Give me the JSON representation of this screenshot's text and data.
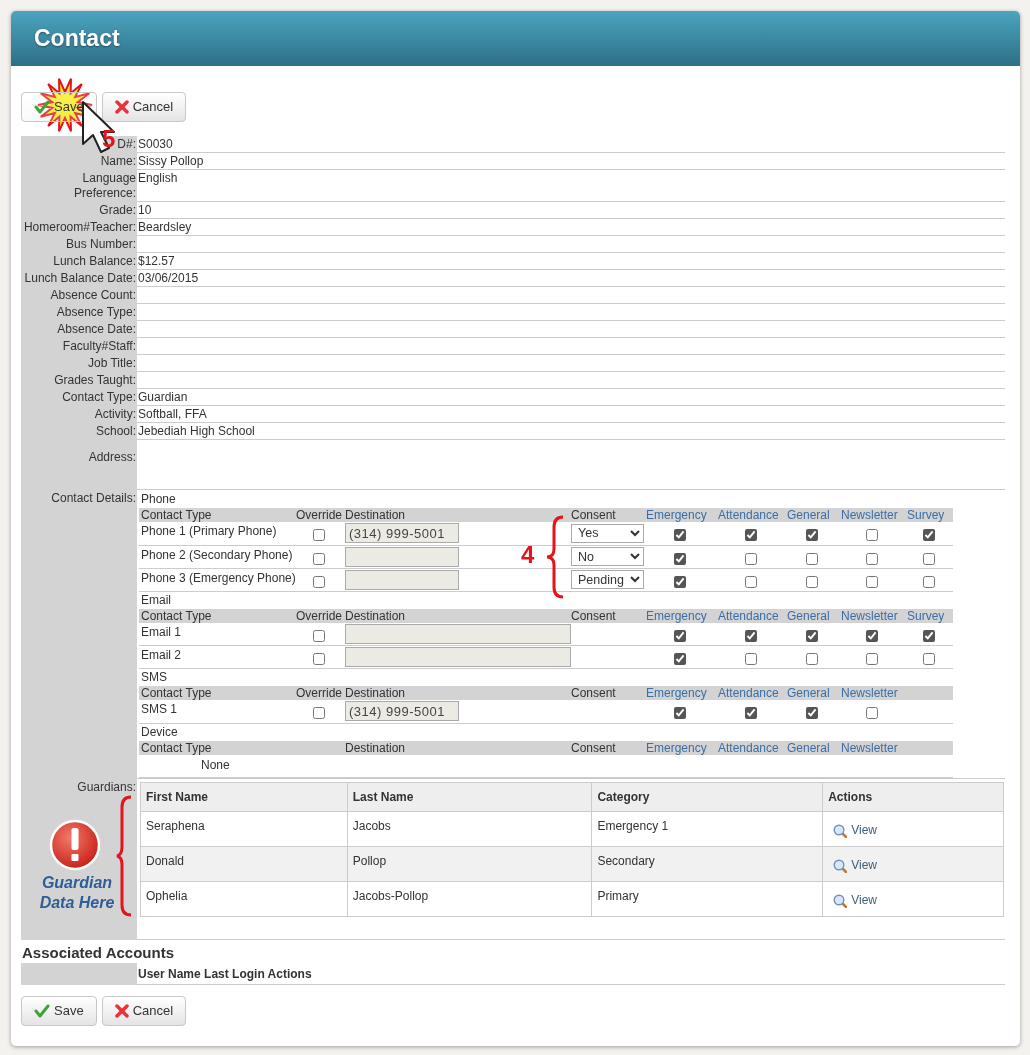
{
  "header": {
    "title": "Contact"
  },
  "top_buttons": [
    {
      "kind": "save",
      "label": "Save"
    },
    {
      "kind": "cancel",
      "label": "Cancel"
    }
  ],
  "top_callout": "5",
  "fields": [
    {
      "kind": "line",
      "label": "D#:",
      "value": "S0030"
    },
    {
      "kind": "line",
      "label": "Name:",
      "value": "Sissy Pollop"
    },
    {
      "kind": "line",
      "label": "Language Preference:",
      "value": "English"
    },
    {
      "kind": "line",
      "label": "Grade:",
      "value": "10"
    },
    {
      "kind": "line",
      "label": "Homeroom#Teacher:",
      "value": "Beardsley"
    },
    {
      "kind": "line",
      "label": "Bus Number:"
    },
    {
      "kind": "line",
      "label": "Lunch Balance:",
      "value": "$12.57"
    },
    {
      "kind": "line",
      "label": "Lunch Balance Date:",
      "value": "03/06/2015"
    },
    {
      "kind": "line",
      "label": "Absence Count:"
    },
    {
      "kind": "line",
      "label": "Absence Type:"
    },
    {
      "kind": "line",
      "label": "Absence Date:"
    },
    {
      "kind": "line",
      "label": "Faculty#Staff:"
    },
    {
      "kind": "line",
      "label": "Job Title:"
    },
    {
      "kind": "line",
      "label": "Grades Taught:"
    },
    {
      "kind": "line",
      "label": "Contact Type:",
      "value": "Guardian"
    },
    {
      "kind": "line",
      "label": "Activity:",
      "value": "Softball, FFA"
    },
    {
      "kind": "line",
      "label": "School:",
      "value": "Jebediah High School"
    },
    {
      "kind": "block",
      "label": "Address:"
    }
  ],
  "contact_details": {
    "label": "Contact Details:",
    "sections": [
      {
        "kind": "phone",
        "title": "Phone",
        "callout": "4",
        "columns": [
          {
            "kind": "type",
            "label": "Contact Type"
          },
          {
            "kind": "override",
            "label": "Override"
          },
          {
            "kind": "destination",
            "label": "Destination"
          },
          {
            "kind": "consent",
            "label": "Consent"
          },
          {
            "kind": "pref",
            "label": "Emergency"
          },
          {
            "kind": "pref",
            "label": "Attendance"
          },
          {
            "kind": "pref",
            "label": "General"
          },
          {
            "kind": "pref",
            "label": "Newsletter"
          },
          {
            "kind": "pref",
            "label": "Survey"
          }
        ],
        "rows": [
          {
            "kind": "entry",
            "contact_type": "Phone 1 (Primary Phone)",
            "override": false,
            "destination": "(314) 999-5001",
            "consent": "Yes",
            "prefs": [
              true,
              true,
              true,
              false,
              true
            ]
          },
          {
            "kind": "entry",
            "contact_type": "Phone 2 (Secondary Phone)",
            "override": false,
            "consent": "No",
            "prefs": [
              true,
              false,
              false,
              false,
              false
            ]
          },
          {
            "kind": "entry",
            "contact_type": "Phone 3 (Emergency Phone)",
            "override": false,
            "consent": "Pending",
            "prefs": [
              true,
              false,
              false,
              false,
              false
            ]
          }
        ]
      },
      {
        "kind": "email",
        "title": "Email",
        "columns": [
          {
            "kind": "type",
            "label": "Contact Type"
          },
          {
            "kind": "override",
            "label": "Override"
          },
          {
            "kind": "destination",
            "label": "Destination"
          },
          {
            "kind": "consent",
            "label": "Consent"
          },
          {
            "kind": "pref",
            "label": "Emergency"
          },
          {
            "kind": "pref",
            "label": "Attendance"
          },
          {
            "kind": "pref",
            "label": "General"
          },
          {
            "kind": "pref",
            "label": "Newsletter"
          },
          {
            "kind": "pref",
            "label": "Survey"
          }
        ],
        "rows": [
          {
            "kind": "entry",
            "contact_type": "Email 1",
            "override": false,
            "prefs": [
              true,
              true,
              true,
              true,
              true
            ]
          },
          {
            "kind": "entry",
            "contact_type": "Email 2",
            "override": false,
            "prefs": [
              true,
              false,
              false,
              false,
              false
            ]
          }
        ]
      },
      {
        "kind": "sms",
        "title": "SMS",
        "columns": [
          {
            "kind": "type",
            "label": "Contact Type"
          },
          {
            "kind": "override",
            "label": "Override"
          },
          {
            "kind": "destination",
            "label": "Destination"
          },
          {
            "kind": "consent",
            "label": "Consent"
          },
          {
            "kind": "pref",
            "label": "Emergency"
          },
          {
            "kind": "pref",
            "label": "Attendance"
          },
          {
            "kind": "pref",
            "label": "General"
          },
          {
            "kind": "pref",
            "label": "Newsletter"
          }
        ],
        "rows": [
          {
            "kind": "entry",
            "contact_type": "SMS 1",
            "override": false,
            "destination": "(314) 999-5001",
            "prefs": [
              true,
              true,
              true,
              false
            ]
          }
        ]
      },
      {
        "kind": "device",
        "title": "Device",
        "columns": [
          {
            "kind": "type",
            "label": "Contact Type"
          },
          {
            "kind": "destination",
            "label": "Destination"
          },
          {
            "kind": "consent",
            "label": "Consent"
          },
          {
            "kind": "pref",
            "label": "Emergency"
          },
          {
            "kind": "pref",
            "label": "Attendance"
          },
          {
            "kind": "pref",
            "label": "General"
          },
          {
            "kind": "pref",
            "label": "Newsletter"
          }
        ],
        "rows": [
          {
            "kind": "empty",
            "text": "None"
          }
        ]
      }
    ]
  },
  "guardians": {
    "label": "Guardians:",
    "note": "Guardian Data Here",
    "columns": [
      "First Name",
      "Last Name",
      "Category",
      "Actions"
    ],
    "rows": [
      {
        "first_name": "Seraphena",
        "last_name": "Jacobs",
        "category": "Emergency 1",
        "action": "View"
      },
      {
        "first_name": "Donald",
        "last_name": "Pollop",
        "category": "Secondary",
        "action": "View"
      },
      {
        "first_name": "Ophelia",
        "last_name": "Jacobs-Pollop",
        "category": "Primary",
        "action": "View"
      }
    ]
  },
  "associated_accounts": {
    "title": "Associated Accounts",
    "columns": [
      "User Name",
      "Last Login",
      "Actions"
    ]
  },
  "bottom_buttons": [
    {
      "kind": "save",
      "label": "Save"
    },
    {
      "kind": "cancel",
      "label": "Cancel"
    }
  ]
}
